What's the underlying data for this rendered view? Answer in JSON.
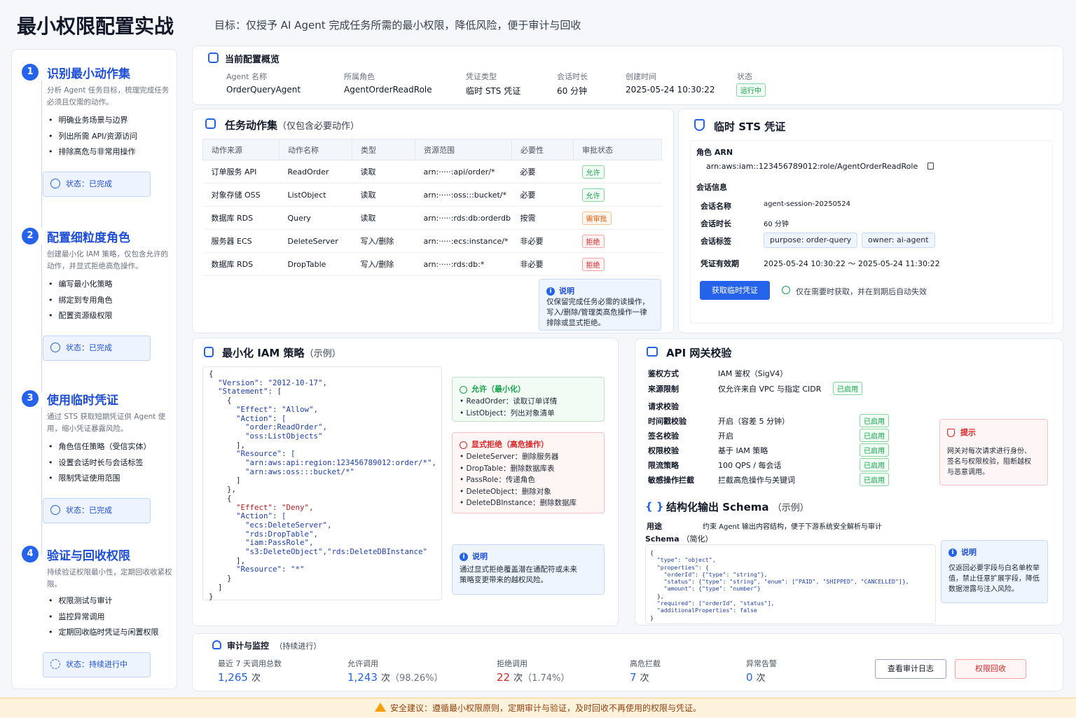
{
  "header": {
    "title": "最小权限配置实战",
    "subtitle": "目标：仅授予 AI Agent 完成任务所需的最小权限，降低风险，便于审计与回收"
  },
  "steps": [
    {
      "num": "1",
      "title": "识别最小动作集",
      "desc": "分析 Agent 任务目标，梳理完成任务必须且仅需的动作。",
      "items": [
        "明确业务场景与边界",
        "列出所需 API/资源访问",
        "排除高危与非常用操作"
      ],
      "status": "状态：已完成"
    },
    {
      "num": "2",
      "title": "配置细粒度角色",
      "desc": "创建最小化 IAM 策略，仅包含允许的动作，并显式拒绝高危操作。",
      "items": [
        "编写最小化策略",
        "绑定到专用角色",
        "配置资源级权限"
      ],
      "status": "状态：已完成"
    },
    {
      "num": "3",
      "title": "使用临时凭证",
      "desc": "通过 STS 获取短期凭证供 Agent 使用，缩小凭证暴露风险。",
      "items": [
        "角色信任策略（受信实体）",
        "设置会话时长与会话标签",
        "限制凭证使用范围"
      ],
      "status": "状态：已完成"
    },
    {
      "num": "4",
      "title": "验证与回收权限",
      "desc": "持续验证权限最小性，定期回收收紧权限。",
      "items": [
        "权限测试与审计",
        "监控异常调用",
        "定期回收临时凭证与闲置权限"
      ],
      "status": "状态：持续进行中"
    }
  ],
  "overview": {
    "title": "当前配置概览",
    "fields": [
      {
        "k": "Agent 名称",
        "v": "OrderQueryAgent"
      },
      {
        "k": "所属角色",
        "v": "AgentOrderReadRole"
      },
      {
        "k": "凭证类型",
        "v": "临时 STS 凭证"
      },
      {
        "k": "会话时长",
        "v": "60 分钟"
      },
      {
        "k": "创建时间",
        "v": "2025-05-24 10:30:22"
      },
      {
        "k": "状态",
        "v": "运行中"
      }
    ]
  },
  "actions": {
    "title": "任务动作集",
    "title_note": "（仅包含必要动作）",
    "headers": [
      "动作来源",
      "动作名称",
      "类型",
      "资源范围",
      "必要性",
      "审批状态"
    ],
    "rows": [
      [
        "订单服务 API",
        "ReadOrder",
        "读取",
        "arn:·····:api/order/*",
        "必要",
        "允许"
      ],
      [
        "对象存储 OSS",
        "ListObject",
        "读取",
        "arn:·····:oss:::bucket/*",
        "必要",
        "允许"
      ],
      [
        "数据库 RDS",
        "Query",
        "读取",
        "arn:·····:rds:db:orderdb",
        "按需",
        "需审批"
      ],
      [
        "服务器 ECS",
        "DeleteServer",
        "写入/删除",
        "arn:·····:ecs:instance/*",
        "非必要",
        "拒绝"
      ],
      [
        "数据库 RDS",
        "DropTable",
        "写入/删除",
        "arn:·····:rds:db:*",
        "非必要",
        "拒绝"
      ]
    ],
    "note_title": "说明",
    "note_lines": [
      "仅保留完成任务必需的读操作，",
      "写入/删除/管理类高危操作一律",
      "排除或显式拒绝。"
    ]
  },
  "sts": {
    "title": "临时 STS 凭证",
    "arn_label": "角色 ARN",
    "arn": "arn:aws:iam::123456789012:role/AgentOrderReadRole",
    "session_label": "会话信息",
    "name_k": "会话名称",
    "name_v": "agent-session-20250524",
    "dur_k": "会话时长",
    "dur_v": "60 分钟",
    "tags_k": "会话标签",
    "tag1": "purpose: order-query",
    "tag2": "owner: ai-agent",
    "valid_k": "凭证有效期",
    "valid_v": "2025-05-24 10:30:22 ～ 2025-05-24 11:30:22",
    "button": "获取临时凭证",
    "hint": "仅在需要时获取，并在到期后自动失效"
  },
  "iam": {
    "title": "最小化 IAM 策略",
    "title_note": "（示例）",
    "code": [
      "{",
      "  \"Version\": \"2012-10-17\",",
      "  \"Statement\": [",
      "    {",
      "      \"Effect\": \"Allow\",",
      "      \"Action\": [",
      "        \"order:ReadOrder\",",
      "        \"oss:ListObjects\"",
      "      ],",
      "      \"Resource\": [",
      "        \"arn:aws:api:region:123456789012:order/*\",",
      "        \"arn:aws:oss:::bucket/*\"",
      "      ]",
      "    },",
      "    {",
      "      \"Effect\": \"Deny\",",
      "      \"Action\": [",
      "        \"ecs:DeleteServer\",",
      "        \"rds:DropTable\",",
      "        \"iam:PassRole\",",
      "        \"s3:DeleteObject\",\"rds:DeleteDBInstance\"",
      "      ],",
      "      \"Resource\": \"*\"",
      "    }",
      "  ]",
      "}"
    ],
    "allow_title": "允许（最小化）",
    "allow_items": [
      "ReadOrder：读取订单详情",
      "ListObject：列出对象清单"
    ],
    "deny_title": "显式拒绝（高危操作）",
    "deny_items": [
      "DeleteServer：删除服务器",
      "DropTable：删除数据库表",
      "PassRole：传递角色",
      "DeleteObject：删除对象",
      "DeleteDBInstance：删除数据库"
    ],
    "note_title": "说明",
    "note_lines": [
      "通过显式拒绝覆盖潜在通配符或未来",
      "策略变更带来的越权风险。"
    ]
  },
  "gateway": {
    "title": "API 网关校验",
    "rows": [
      {
        "k": "鉴权方式",
        "v": "IAM 鉴权（SigV4）",
        "tag": ""
      },
      {
        "k": "来源限制",
        "v": "仅允许来自 VPC 与指定 CIDR",
        "tag": "已启用"
      },
      {
        "k": "请求校验",
        "v": "",
        "tag": ""
      },
      {
        "k": "时间戳校验",
        "v": "开启（容差 5 分钟）",
        "tag": "已启用"
      },
      {
        "k": "签名校验",
        "v": "开启",
        "tag": "已启用"
      },
      {
        "k": "权限校验",
        "v": "基于 IAM 策略",
        "tag": "已启用"
      },
      {
        "k": "限流策略",
        "v": "100 QPS / 每会话",
        "tag": "已启用"
      },
      {
        "k": "敏感操作拦截",
        "v": "拦截高危操作与关键词",
        "tag": "已启用"
      }
    ],
    "tip_title": "提示",
    "tip_lines": [
      "网关对每次请求进行身份、",
      "签名与权限校验，阻断越权",
      "与恶意调用。"
    ]
  },
  "schema": {
    "title": "结构化输出 Schema",
    "title_note": "（示例）",
    "use_k": "用途",
    "use_v": "约束 Agent 输出内容结构，便于下游系统安全解析与审计",
    "schema_k": "Schema",
    "schema_note": "（简化）",
    "code": [
      "{",
      "  \"type\": \"object\",",
      "  \"properties\": {",
      "    \"orderId\": {\"type\": \"string\"},",
      "    \"status\": {\"type\": \"string\", \"enum\": [\"PAID\", \"SHIPPED\", \"CANCELLED\"]},",
      "    \"amount\": {\"type\": \"number\"}",
      "  },",
      "  \"required\": [\"orderId\", \"status\"],",
      "  \"additionalProperties\": false",
      "}"
    ],
    "note_title": "说明",
    "note_lines": [
      "仅返回必要字段与白名单枚举",
      "值，禁止任意扩展字段，降低",
      "数据泄露与注入风险。"
    ]
  },
  "audit": {
    "title": "审计与监控",
    "title_note": "（持续进行）",
    "stats": [
      {
        "label": "最近 7 天调用总数",
        "value": "1,265",
        "unit": "次",
        "extra": ""
      },
      {
        "label": "允许调用",
        "value": "1,243",
        "unit": "次",
        "extra": "（98.26%）"
      },
      {
        "label": "拒绝调用",
        "value": "22",
        "unit": "次",
        "extra": "（1.74%）"
      },
      {
        "label": "高危拦截",
        "value": "7",
        "unit": "次",
        "extra": ""
      },
      {
        "label": "异常告警",
        "value": "0",
        "unit": "次",
        "extra": ""
      }
    ],
    "btn_log": "查看审计日志",
    "btn_revoke": "权限回收"
  },
  "footer": "安全建议：遵循最小权限原则，定期审计与验证，及时回收不再使用的权限与凭证。",
  "colors": {
    "accent": "#2563eb",
    "allow": "#16a34a",
    "review": "#ea580c",
    "deny": "#dc2626"
  }
}
